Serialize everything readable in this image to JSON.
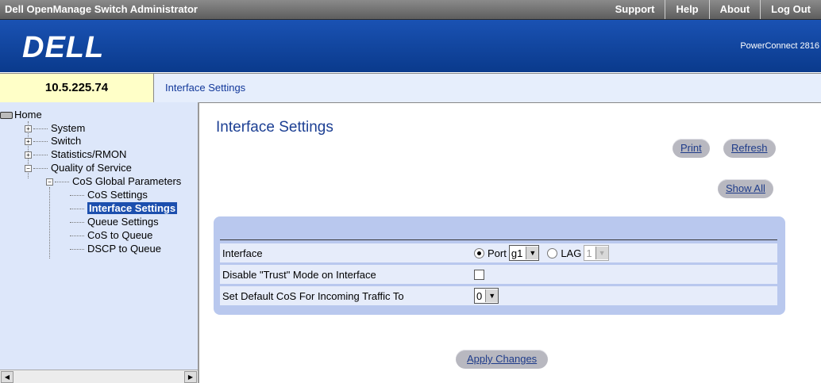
{
  "app": {
    "title": "Dell OpenManage Switch Administrator",
    "top_links": [
      "Support",
      "Help",
      "About",
      "Log Out"
    ],
    "logo": "DELL",
    "model": "PowerConnect 2816"
  },
  "ip_address": "10.5.225.74",
  "breadcrumb": "Interface Settings",
  "sidebar": {
    "home": "Home",
    "items": {
      "system": "System",
      "switch": "Switch",
      "statistics": "Statistics/RMON",
      "qos": "Quality of Service",
      "cos_global": "CoS Global Parameters",
      "cos_settings": "CoS Settings",
      "interface_settings": "Interface Settings",
      "queue_settings": "Queue Settings",
      "cos_to_queue": "CoS to Queue",
      "dscp_to_queue": "DSCP to Queue"
    },
    "selected": "Interface Settings"
  },
  "main": {
    "title": "Interface Settings",
    "print_label": "Print",
    "refresh_label": "Refresh",
    "show_all_label": "Show All",
    "apply_label": "Apply Changes",
    "form": {
      "interface_label": "Interface",
      "port_label": "Port",
      "port_value": "g1",
      "lag_label": "LAG",
      "lag_value": "1",
      "port_selected": true,
      "trust_label": "Disable \"Trust\" Mode on Interface",
      "trust_checked": false,
      "default_cos_label": "Set Default CoS For Incoming Traffic To",
      "default_cos_value": "0"
    }
  }
}
